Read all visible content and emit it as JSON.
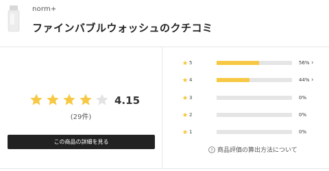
{
  "header": {
    "brand": "norm+",
    "title": "ファインバブルウォッシュのクチコミ"
  },
  "summary": {
    "rating": "4.15",
    "rating_value": 4.15,
    "review_count": "(29件)",
    "detail_button_label": "この商品の詳細を見る"
  },
  "distribution": [
    {
      "label": "5",
      "percent": 56,
      "percent_label": "56%",
      "chevron": "›"
    },
    {
      "label": "4",
      "percent": 44,
      "percent_label": "44%",
      "chevron": "›"
    },
    {
      "label": "3",
      "percent": 0,
      "percent_label": "0%",
      "chevron": ""
    },
    {
      "label": "2",
      "percent": 0,
      "percent_label": "0%",
      "chevron": ""
    },
    {
      "label": "1",
      "percent": 0,
      "percent_label": "0%",
      "chevron": ""
    }
  ],
  "help": {
    "label": "商品評価の算出方法について",
    "icon": "question-circle-icon"
  },
  "colors": {
    "star_filled": "#f7c843",
    "star_empty": "#e3e3e3",
    "bar_fill": "#f7c843",
    "bar_track": "#e5e5e5",
    "button_bg": "#222222"
  }
}
